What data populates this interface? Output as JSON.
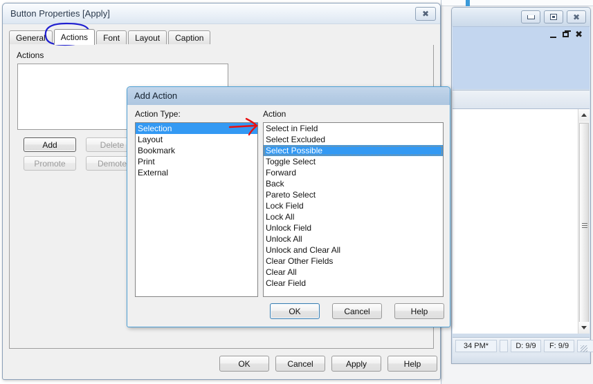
{
  "main_dialog": {
    "title": "Button Properties [Apply]",
    "close_icon": "close-icon",
    "tabs": [
      {
        "label": "General",
        "active": false
      },
      {
        "label": "Actions",
        "active": true
      },
      {
        "label": "Font",
        "active": false
      },
      {
        "label": "Layout",
        "active": false
      },
      {
        "label": "Caption",
        "active": false
      }
    ],
    "group_label": "Actions",
    "actions_list_items": [],
    "buttons": {
      "add": "Add",
      "delete": "Delete",
      "promote": "Promote",
      "demote": "Demote"
    },
    "button_states": {
      "add": "enabled",
      "delete": "disabled",
      "promote": "disabled",
      "demote": "disabled"
    },
    "footer_buttons": {
      "ok": "OK",
      "cancel": "Cancel",
      "apply": "Apply",
      "help": "Help"
    }
  },
  "add_action_dialog": {
    "title": "Add Action",
    "action_type_label": "Action Type:",
    "action_label": "Action",
    "action_types": [
      "Selection",
      "Layout",
      "Bookmark",
      "Print",
      "External"
    ],
    "selected_action_type": "Selection",
    "actions": [
      "Select in Field",
      "Select Excluded",
      "Select Possible",
      "Toggle Select",
      "Forward",
      "Back",
      "Pareto Select",
      "Lock Field",
      "Lock All",
      "Unlock Field",
      "Unlock All",
      "Unlock and Clear All",
      "Clear Other Fields",
      "Clear All",
      "Clear Field"
    ],
    "selected_action": "Select Possible",
    "buttons": {
      "ok": "OK",
      "cancel": "Cancel",
      "help": "Help"
    },
    "default_button": "OK"
  },
  "background_window": {
    "window_buttons": {
      "minimize": "minimize-icon",
      "maximize": "maximize-icon",
      "close": "close-icon"
    },
    "mdi_child_buttons": {
      "minimize": "minimize-icon",
      "restore": "restore-icon",
      "close": "close-icon"
    },
    "status_bar": {
      "cells": [
        "34 PM*",
        "",
        "D: 9/9",
        "F: 9/9",
        "",
        ""
      ]
    },
    "scrollbar": {
      "up_arrow": "scroll-up-icon",
      "down_arrow": "scroll-down-icon"
    }
  },
  "annotations": {
    "circle": {
      "target": "Actions tab",
      "color": "#2020d0"
    },
    "arrow": {
      "target": "Action list",
      "color": "#e81010"
    }
  }
}
